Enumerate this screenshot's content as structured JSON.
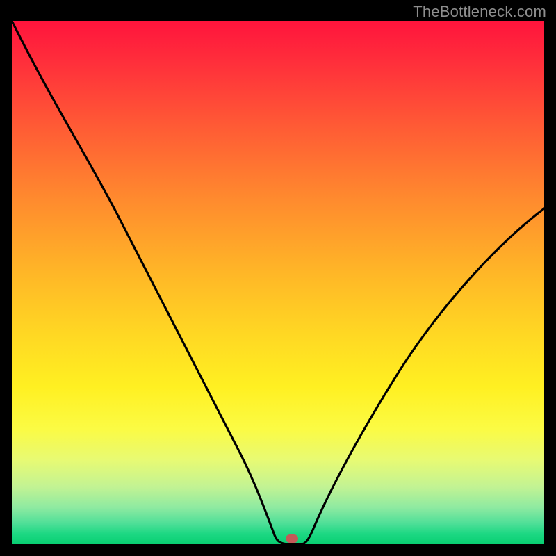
{
  "watermark": "TheBottleneck.com",
  "colors": {
    "curve_stroke": "#000000",
    "minimum_marker": "#c35a58",
    "frame_bg": "#000000"
  },
  "chart_data": {
    "type": "line",
    "title": "",
    "xlabel": "",
    "ylabel": "",
    "xlim": [
      0,
      100
    ],
    "ylim": [
      0,
      100
    ],
    "series": [
      {
        "name": "bottleneck-curve",
        "x": [
          0,
          5,
          10,
          15,
          20,
          25,
          30,
          35,
          40,
          45,
          48,
          50,
          52,
          54,
          56,
          60,
          65,
          70,
          75,
          80,
          85,
          90,
          95,
          100
        ],
        "values": [
          100,
          91,
          82,
          73,
          65,
          57,
          49,
          41,
          33,
          22,
          12,
          3,
          0,
          0,
          2,
          9,
          19,
          28,
          36,
          43,
          49,
          55,
          60,
          64
        ]
      }
    ],
    "annotations": [
      {
        "name": "minimum-marker",
        "x": 53,
        "y": 0
      }
    ]
  }
}
